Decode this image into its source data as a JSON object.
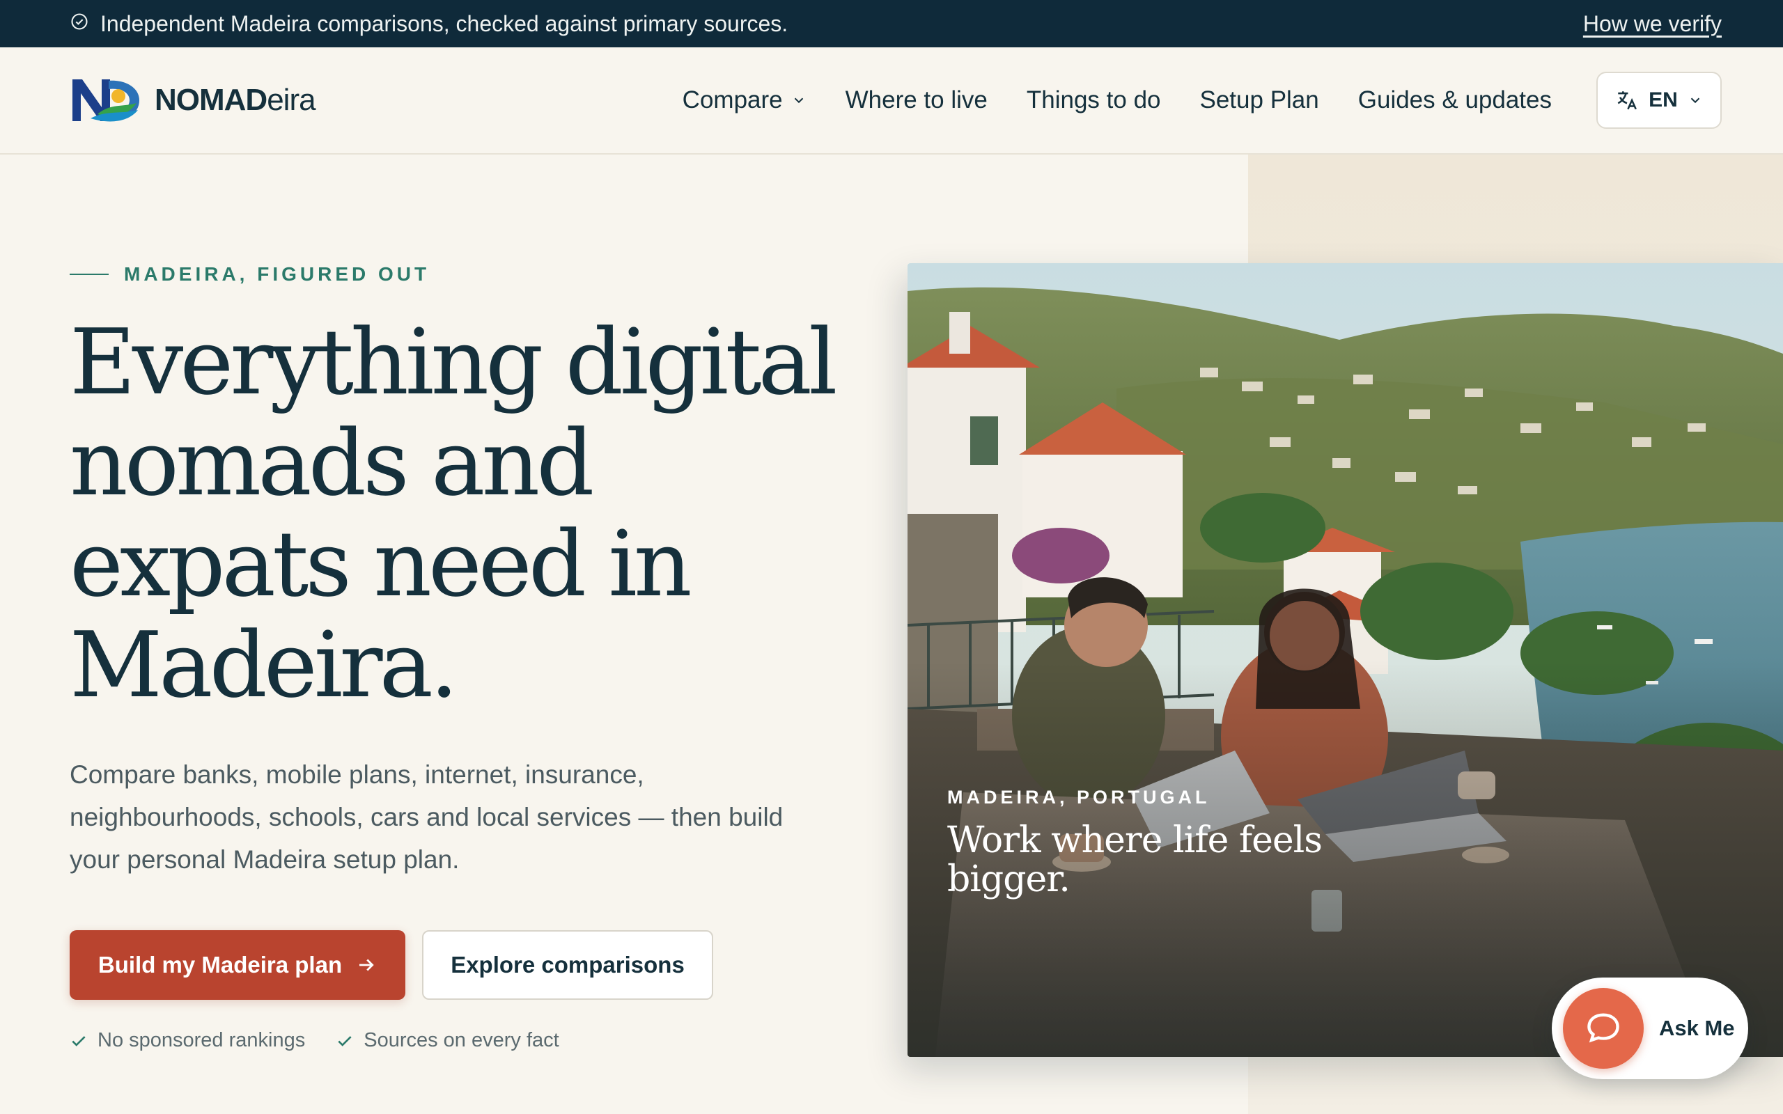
{
  "topbar": {
    "message": "Independent Madeira comparisons, checked against primary sources.",
    "link": "How we verify"
  },
  "header": {
    "logo_bold": "NOMAD",
    "logo_light": "eira",
    "nav": [
      {
        "label": "Compare"
      },
      {
        "label": "Where to live"
      },
      {
        "label": "Things to do"
      },
      {
        "label": "Setup Plan"
      },
      {
        "label": "Guides & updates"
      }
    ],
    "language": "EN"
  },
  "hero": {
    "eyebrow": "MADEIRA, FIGURED OUT",
    "headline": "Everything digital nomads and expats need in Madeira.",
    "lede": "Compare banks, mobile plans, internet, insurance, neighbourhoods, schools, cars and local services — then build your personal Madeira setup plan.",
    "primary_cta": "Build my Madeira plan",
    "secondary_cta": "Explore comparisons",
    "checks": [
      "No sponsored rankings",
      "Sources on every fact"
    ],
    "image_kicker": "MADEIRA, PORTUGAL",
    "image_title": "Work where life feels bigger."
  },
  "chat": {
    "label": "Ask Me"
  },
  "colors": {
    "navy": "#0f2a3a",
    "accent": "#b9442f",
    "teal": "#2b7a6a",
    "background": "#f8f5ee"
  }
}
